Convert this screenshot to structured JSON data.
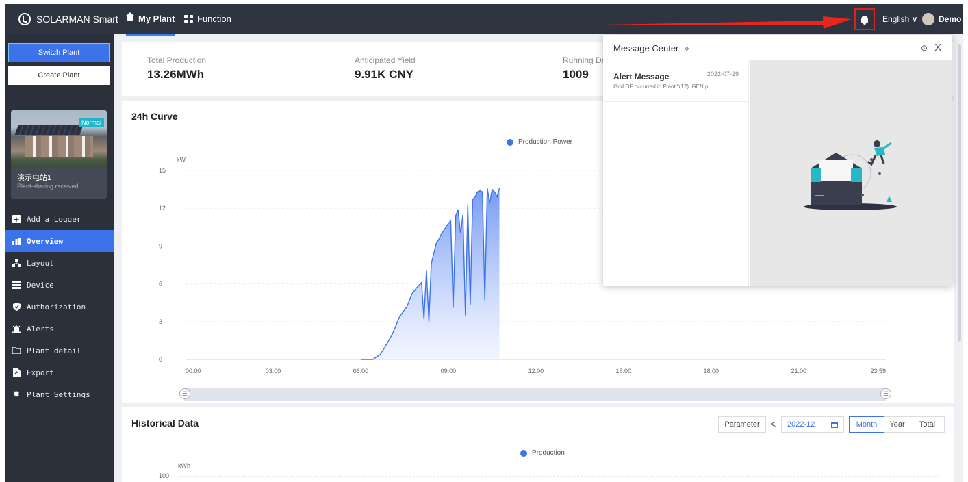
{
  "topbar": {
    "brand": "SOLARMAN Smart",
    "tabs": [
      {
        "label": "My Plant",
        "icon": "home-icon"
      },
      {
        "label": "Function",
        "icon": "function-grid-icon"
      }
    ],
    "language": "English ∨",
    "user": "Demo"
  },
  "sidebar": {
    "switch_plant": "Switch Plant",
    "create_plant": "Create Plant",
    "plant": {
      "name": "演示电站1",
      "subtitle": "Plant-sharing received",
      "status": "Normal"
    },
    "items": [
      {
        "label": "Add a Logger",
        "icon": "plus-square-icon"
      },
      {
        "label": "Overview",
        "icon": "bar-chart-icon"
      },
      {
        "label": "Layout",
        "icon": "layout-icon"
      },
      {
        "label": "Device",
        "icon": "device-icon"
      },
      {
        "label": "Authorization",
        "icon": "shield-icon"
      },
      {
        "label": "Alerts",
        "icon": "alarm-icon"
      },
      {
        "label": "Plant detail",
        "icon": "folder-icon"
      },
      {
        "label": "Export",
        "icon": "export-icon"
      },
      {
        "label": "Plant Settings",
        "icon": "gear-icon"
      }
    ],
    "active_item": "Overview"
  },
  "stats": [
    {
      "label": "Total Production",
      "value": "13.26MWh"
    },
    {
      "label": "Anticipated Yield",
      "value": "9.91K CNY"
    },
    {
      "label": "Running Da",
      "value": "1009"
    }
  ],
  "curve": {
    "title": "24h Curve",
    "legend": "Production Power"
  },
  "history": {
    "title": "Historical Data",
    "legend": "Production",
    "unit": "kWh",
    "y_top": "100",
    "parameter": "Parameter",
    "prev": "<",
    "month_value": "2022-12",
    "ranges": [
      "Month",
      "Year",
      "Total"
    ],
    "active_range": "Month"
  },
  "message_center": {
    "title": "Message Center",
    "close": "X",
    "items": [
      {
        "title": "Alert Message",
        "date": "2022-07-29",
        "text": "Grid OF occurred in Plant \"(17) IGEN p..."
      }
    ]
  },
  "colors": {
    "accent": "#3c72ea",
    "topbar": "#2e3440",
    "sidebar": "#2b303b",
    "annotation": "#e02020"
  },
  "chart_data": {
    "type": "area",
    "title": "24h Curve",
    "ylabel": "kW",
    "series": [
      {
        "name": "Production Power"
      }
    ],
    "ylim": [
      0,
      15
    ],
    "yticks": [
      "0",
      "3",
      "6",
      "9",
      "12",
      "15"
    ],
    "xticks": [
      "00:00",
      "03:00",
      "06:00",
      "09:00",
      "12:00",
      "15:00",
      "18:00",
      "21:00",
      "23:59"
    ],
    "x": [
      "06:00",
      "06:25",
      "06:40",
      "06:50",
      "07:05",
      "07:20",
      "07:35",
      "07:45",
      "07:55",
      "08:05",
      "08:10",
      "08:15",
      "08:20",
      "08:25",
      "08:30",
      "08:35",
      "08:40",
      "08:45",
      "08:50",
      "08:55",
      "09:00",
      "09:05",
      "09:10",
      "09:15",
      "09:20",
      "09:25",
      "09:30",
      "09:35",
      "09:40",
      "09:45",
      "09:50",
      "09:55",
      "10:00",
      "10:05",
      "10:10",
      "10:15",
      "10:20",
      "10:25",
      "10:30",
      "10:35",
      "10:40",
      "10:45",
      "10:50",
      "10:55",
      "11:00",
      "11:05",
      "11:10",
      "11:15",
      "11:20",
      "11:25",
      "11:30",
      "11:35"
    ],
    "values": [
      0,
      0,
      0.4,
      1.0,
      2.0,
      3.4,
      4.2,
      5.2,
      5.7,
      6.1,
      3.2,
      7.1,
      3.0,
      7.6,
      8.4,
      9.2,
      9.5,
      9.9,
      10.2,
      10.5,
      10.8,
      11.0,
      4.1,
      11.4,
      11.9,
      10.0,
      11.5,
      3.5,
      12.3,
      4.3,
      12.7,
      12.9,
      13.3,
      13.4,
      13.3,
      4.7,
      13.6,
      12.4,
      13.5,
      13.3,
      12.9,
      13.6
    ],
    "grid": true
  }
}
